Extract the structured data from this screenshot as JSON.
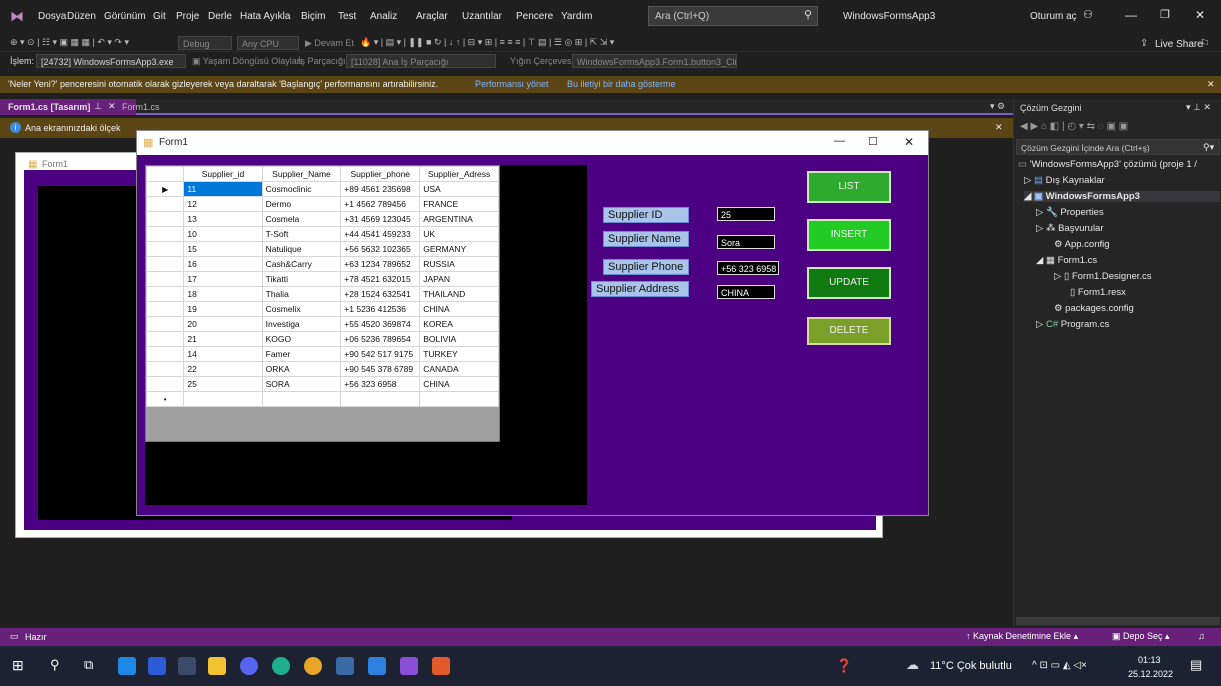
{
  "menu": {
    "items": [
      "Dosya",
      "Düzen",
      "Görünüm",
      "Git",
      "Proje",
      "Derle",
      "Hata Ayıkla",
      "Biçim",
      "Test",
      "Analiz",
      "Araçlar",
      "Uzantılar",
      "Pencere",
      "Yardım"
    ],
    "search": "Ara (Ctrl+Q)",
    "app_title": "WindowsFormsApp3",
    "signin": "Oturum aç",
    "live_share": "Live Share"
  },
  "toolbar": {
    "debug_config": "Debug",
    "cpu": "Any CPU",
    "continue": "Devam Et",
    "process_label": "İşlem:",
    "process": "[24732] WindowsFormsApp3.exe",
    "lifecycle": "Yaşam Döngüsü Olayları",
    "thread_label": "İş Parçacığı:",
    "thread": "[11028] Ana İş Parçacığı",
    "stack_label": "Yığın Çerçevesi:",
    "stack": "WindowsFormsApp3.Form1.button3_Click"
  },
  "infobar": {
    "message": "'Neler Yeni?' penceresini otomatik olarak gizleyerek veya daraltarak 'Başlangıç' performansını artırabilirsiniz.",
    "link1": "Performansı yönet",
    "link2": "Bu iletiyi bir daha gösterme"
  },
  "tabs": {
    "active": "Form1.cs [Tasarım]",
    "inactive": "Form1.cs"
  },
  "warning": {
    "text": "Ana ekranınızdaki ölçek"
  },
  "designer": {
    "form_title": "Form1"
  },
  "runtime": {
    "title": "Form1",
    "grid": {
      "columns": [
        "Supplier_id",
        "Supplier_Name",
        "Supplier_phone",
        "Supplier_Adress"
      ],
      "rows": [
        [
          "11",
          "Cosmoclinic",
          "+89 4561 235698",
          "USA"
        ],
        [
          "12",
          "Dermo",
          "+1 4562 789456",
          "FRANCE"
        ],
        [
          "13",
          "Cosmela",
          "+31 4569 123045",
          "ARGENTINA"
        ],
        [
          "10",
          "T-Soft",
          "+44 4541 459233",
          "UK"
        ],
        [
          "15",
          "Natulique",
          "+56 5632 102365",
          "GERMANY"
        ],
        [
          "16",
          "Cash&Carry",
          "+63 1234 789652",
          "RUSSIA"
        ],
        [
          "17",
          "Tikatti",
          "+78 4521 632015",
          "JAPAN"
        ],
        [
          "18",
          "Thalia",
          "+28 1524 632541",
          "THAILAND"
        ],
        [
          "19",
          "Cosmelix",
          "+1 5236 412536",
          "CHINA"
        ],
        [
          "20",
          "Investiga",
          "+55 4520 369874",
          "KOREA"
        ],
        [
          "21",
          "KOGO",
          "+06 5236 789654",
          "BOLIVIA"
        ],
        [
          "14",
          "Famer",
          "+90 542 517 9175",
          "TURKEY"
        ],
        [
          "22",
          "ORKA",
          "+90 545 378 6789",
          "CANADA"
        ],
        [
          "25",
          "SORA",
          "+56 323 6958",
          "CHINA"
        ]
      ]
    },
    "labels": {
      "id": "Supplier ID",
      "name": "Supplier Name",
      "phone": "Supplier Phone",
      "address": "Supplier Address"
    },
    "values": {
      "id": "25",
      "name": "Sora",
      "phone": "+56 323 6958",
      "address": "CHINA"
    },
    "buttons": {
      "list": "LIST",
      "insert": "INSERT",
      "update": "UPDATE",
      "delete": "DELETE"
    }
  },
  "solution": {
    "title": "Çözüm Gezgini",
    "search": "Çözüm Gezgini İçinde Ara (Ctrl+ş)",
    "items": [
      "'WindowsFormsApp3' çözümü (proje 1 /",
      "Dış Kaynaklar",
      "WindowsFormsApp3",
      "Properties",
      "Başvurular",
      "App.config",
      "Form1.cs",
      "Form1.Designer.cs",
      "Form1.resx",
      "packages.config",
      "Program.cs"
    ]
  },
  "status": {
    "ready": "Hazır",
    "source_control": "Kaynak Denetimine Ekle",
    "repo": "Depo Seç"
  },
  "taskbar": {
    "weather": "11°C Çok bulutlu",
    "time": "01:13",
    "date": "25.12.2022"
  },
  "colors": {
    "form_bg": "#4c0082",
    "accent": "#68217a",
    "selection": "#0078d7"
  }
}
